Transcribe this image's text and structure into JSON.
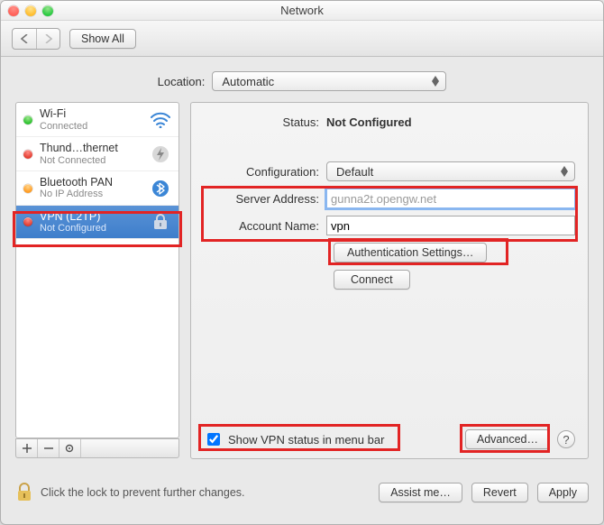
{
  "window": {
    "title": "Network"
  },
  "toolbar": {
    "show_all": "Show All"
  },
  "location": {
    "label": "Location:",
    "value": "Automatic"
  },
  "sidebar": {
    "items": [
      {
        "name": "Wi-Fi",
        "sub": "Connected",
        "status": "green",
        "icon": "wifi"
      },
      {
        "name": "Thund…thernet",
        "sub": "Not Connected",
        "status": "red",
        "icon": "thunderbolt"
      },
      {
        "name": "Bluetooth PAN",
        "sub": "No IP Address",
        "status": "orange",
        "icon": "bluetooth"
      },
      {
        "name": "VPN (L2TP)",
        "sub": "Not Configured",
        "status": "red",
        "icon": "vpn"
      }
    ]
  },
  "detail": {
    "status_label": "Status:",
    "status_value": "Not Configured",
    "config_label": "Configuration:",
    "config_value": "Default",
    "server_label": "Server Address:",
    "server_value": "gunna2t.opengw.net",
    "account_label": "Account Name:",
    "account_value": "vpn",
    "auth_btn": "Authentication Settings…",
    "connect_btn": "Connect",
    "show_status_label": "Show VPN status in menu bar",
    "show_status_checked": true,
    "advanced_btn": "Advanced…"
  },
  "footer": {
    "lock_text": "Click the lock to prevent further changes.",
    "assist": "Assist me…",
    "revert": "Revert",
    "apply": "Apply"
  }
}
